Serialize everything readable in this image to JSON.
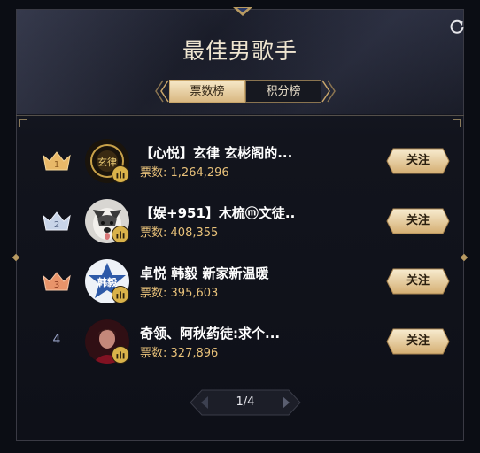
{
  "header": {
    "title": "最佳男歌手",
    "refresh_icon": "refresh-icon"
  },
  "tabs": [
    {
      "label": "票数榜",
      "active": true
    },
    {
      "label": "积分榜",
      "active": false
    }
  ],
  "rankings": [
    {
      "rank": "1",
      "rank_style": "gold-crown",
      "name": "【心悦】玄律 玄彬阁的...",
      "votes_label": "票数:",
      "votes": "1,264,296",
      "follow_label": "关注",
      "avatar": "avatar-gold-emblem"
    },
    {
      "rank": "2",
      "rank_style": "silver-crown",
      "name": "【娱+951】木梳ⓜ文徒..",
      "votes_label": "票数:",
      "votes": "408,355",
      "follow_label": "关注",
      "avatar": "avatar-husky-dog"
    },
    {
      "rank": "3",
      "rank_style": "bronze-crown",
      "name": "卓悦 韩毅 新家新温暖",
      "votes_label": "票数:",
      "votes": "395,603",
      "follow_label": "关注",
      "avatar": "avatar-hanyi-star"
    },
    {
      "rank": "4",
      "rank_style": "plain",
      "name": "奇领、阿秋药徒:求个...",
      "votes_label": "票数:",
      "votes": "327,896",
      "follow_label": "关注",
      "avatar": "avatar-person-red"
    }
  ],
  "avatar_texts": {
    "gold": "玄律",
    "star": "韩毅"
  },
  "pagination": {
    "text": "1/4"
  },
  "colors": {
    "gold_accent": "#d9b882",
    "votes_text": "#e9c27a",
    "background": "#0b0d14"
  }
}
